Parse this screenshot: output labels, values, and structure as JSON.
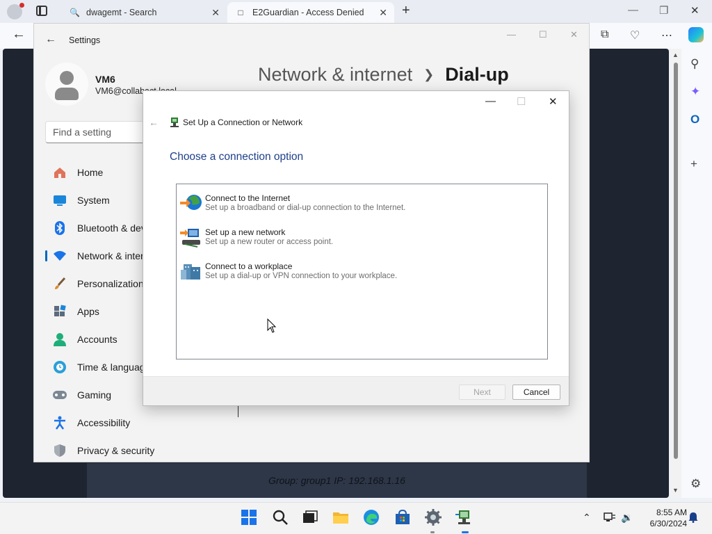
{
  "browser": {
    "tabs": [
      {
        "label": "dwagemt - Search",
        "icon": "search-icon"
      },
      {
        "label": "E2Guardian - Access Denied",
        "icon": "page-icon"
      }
    ],
    "window_controls": {
      "minimize": "—",
      "restore": "❐",
      "close": "✕"
    }
  },
  "settings": {
    "title": "Settings",
    "user": {
      "name": "VM6",
      "email": "VM6@collabact.local"
    },
    "search_placeholder": "Find a setting",
    "breadcrumb": {
      "parent": "Network & internet",
      "current": "Dial-up"
    },
    "nav": [
      {
        "label": "Home",
        "icon": "home-icon"
      },
      {
        "label": "System",
        "icon": "system-icon"
      },
      {
        "label": "Bluetooth & devices",
        "icon": "bluetooth-icon"
      },
      {
        "label": "Network & internet",
        "icon": "wifi-icon",
        "active": true
      },
      {
        "label": "Personalization",
        "icon": "brush-icon"
      },
      {
        "label": "Apps",
        "icon": "apps-icon"
      },
      {
        "label": "Accounts",
        "icon": "account-icon"
      },
      {
        "label": "Time & language",
        "icon": "globe-clock-icon"
      },
      {
        "label": "Gaming",
        "icon": "gamepad-icon"
      },
      {
        "label": "Accessibility",
        "icon": "accessibility-icon"
      },
      {
        "label": "Privacy & security",
        "icon": "shield-icon"
      }
    ]
  },
  "page_status": "Group: group1    IP: 192.168.1.16",
  "dialog": {
    "title": "Set Up a Connection or Network",
    "heading": "Choose a connection option",
    "options": [
      {
        "title": "Connect to the Internet",
        "description": "Set up a broadband or dial-up connection to the Internet.",
        "icon": "globe-internet-icon"
      },
      {
        "title": "Set up a new network",
        "description": "Set up a new router or access point.",
        "icon": "new-network-icon"
      },
      {
        "title": "Connect to a workplace",
        "description": "Set up a dial-up or VPN connection to your workplace.",
        "icon": "workplace-icon"
      }
    ],
    "buttons": {
      "next": "Next",
      "cancel": "Cancel"
    },
    "next_enabled": false
  },
  "taskbar": {
    "apps": [
      "start-icon",
      "search-icon",
      "task-view-icon",
      "file-explorer-icon",
      "edge-icon",
      "store-icon",
      "settings-icon",
      "network-setup-icon"
    ],
    "time": "8:55 AM",
    "date": "6/30/2024"
  },
  "colors": {
    "accent": "#0067c0",
    "dialog_heading": "#1e3f8a"
  }
}
